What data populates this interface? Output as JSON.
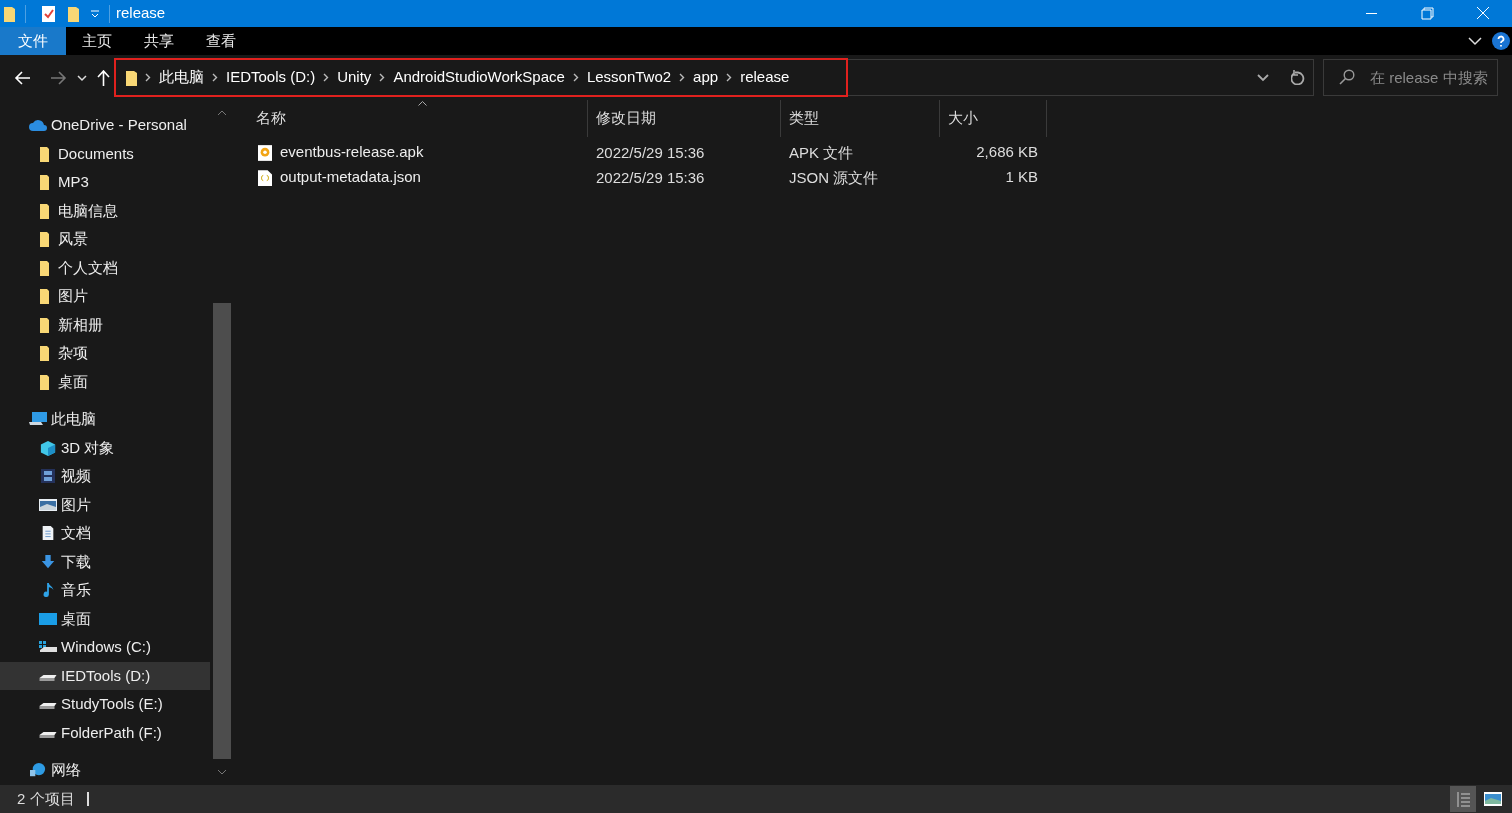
{
  "window": {
    "title": "release"
  },
  "ribbon_tabs": [
    {
      "label": "文件",
      "selected": true
    },
    {
      "label": "主页",
      "selected": false
    },
    {
      "label": "共享",
      "selected": false
    },
    {
      "label": "查看",
      "selected": false
    }
  ],
  "address_bar": {
    "path": [
      "此电脑",
      "IEDTools (D:)",
      "Unity",
      "AndroidStudioWorkSpace",
      "LessonTwo2",
      "app",
      "release"
    ],
    "highlighted": true
  },
  "search": {
    "placeholder": "在 release 中搜索"
  },
  "sidebar": {
    "items": [
      {
        "label": "OneDrive - Personal",
        "kind": "cloud",
        "selected": false,
        "children": [
          {
            "label": "Documents",
            "kind": "folder",
            "selected": false
          },
          {
            "label": "MP3",
            "kind": "folder",
            "selected": false
          },
          {
            "label": "电脑信息",
            "kind": "folder",
            "selected": false
          },
          {
            "label": "风景",
            "kind": "folder",
            "selected": false
          },
          {
            "label": "个人文档",
            "kind": "folder",
            "selected": false
          },
          {
            "label": "图片",
            "kind": "folder",
            "selected": false
          },
          {
            "label": "新相册",
            "kind": "folder",
            "selected": false
          },
          {
            "label": "杂项",
            "kind": "folder",
            "selected": false
          },
          {
            "label": "桌面",
            "kind": "folder",
            "selected": false
          }
        ]
      },
      {
        "label": "此电脑",
        "kind": "pc",
        "selected": false,
        "children": [
          {
            "label": "3D 对象",
            "kind": "cube",
            "selected": false
          },
          {
            "label": "视频",
            "kind": "video",
            "selected": false
          },
          {
            "label": "图片",
            "kind": "pictures",
            "selected": false
          },
          {
            "label": "文档",
            "kind": "document",
            "selected": false
          },
          {
            "label": "下载",
            "kind": "download",
            "selected": false
          },
          {
            "label": "音乐",
            "kind": "music",
            "selected": false
          },
          {
            "label": "桌面",
            "kind": "desktop",
            "selected": false
          },
          {
            "label": "Windows (C:)",
            "kind": "system-drive",
            "selected": false
          },
          {
            "label": "IEDTools (D:)",
            "kind": "drive",
            "selected": true
          },
          {
            "label": "StudyTools (E:)",
            "kind": "drive",
            "selected": false
          },
          {
            "label": "FolderPath (F:)",
            "kind": "drive",
            "selected": false
          }
        ]
      },
      {
        "label": "网络",
        "kind": "network",
        "selected": false
      }
    ]
  },
  "table": {
    "columns": [
      "名称",
      "修改日期",
      "类型",
      "大小"
    ],
    "rows": [
      {
        "name": "eventbus-release.apk",
        "kind": "apk",
        "modified": "2022/5/29 15:36",
        "type": "APK 文件",
        "size": "2,686 KB"
      },
      {
        "name": "output-metadata.json",
        "kind": "json",
        "modified": "2022/5/29 15:36",
        "type": "JSON 源文件",
        "size": "1 KB"
      }
    ]
  },
  "status_bar": {
    "count": "2 个项目"
  }
}
